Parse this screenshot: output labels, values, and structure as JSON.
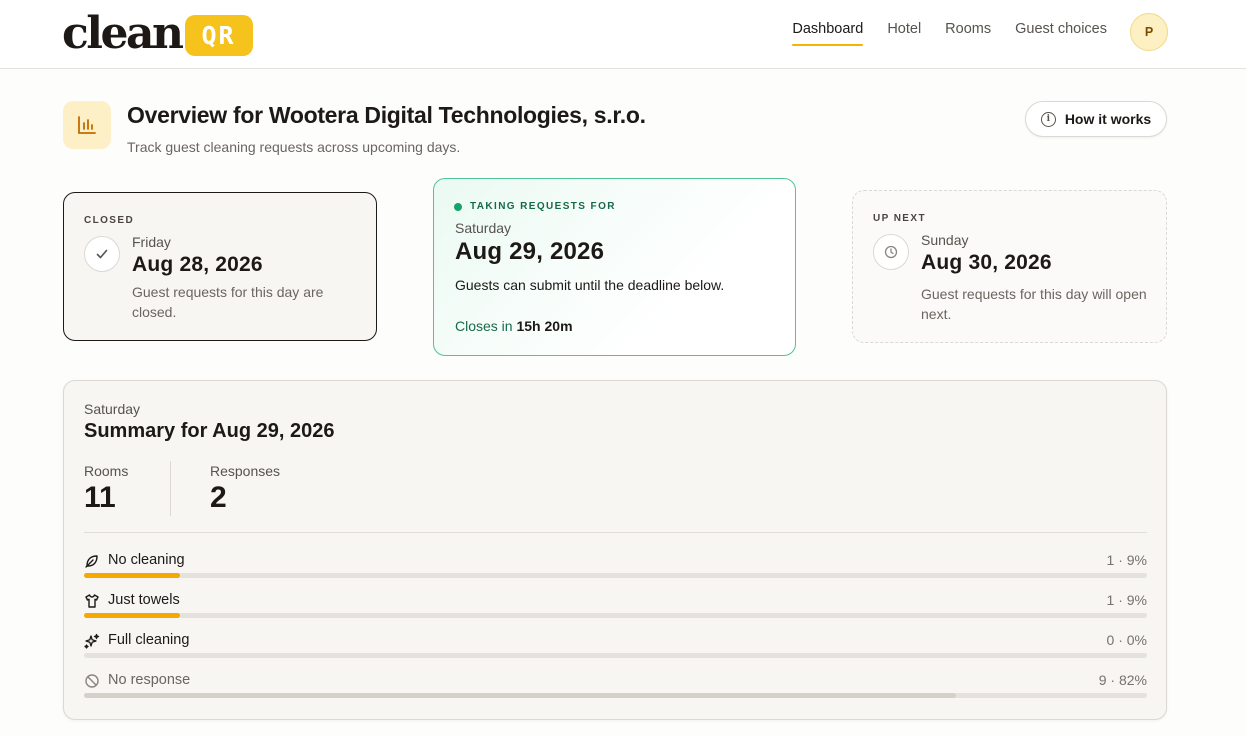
{
  "brand": {
    "word": "clean",
    "badge": "QR",
    "accent": "#f6c21c"
  },
  "nav": {
    "items": [
      {
        "label": "Dashboard",
        "active": true
      },
      {
        "label": "Hotel",
        "active": false
      },
      {
        "label": "Rooms",
        "active": false
      },
      {
        "label": "Guest choices",
        "active": false
      }
    ],
    "avatar_initial": "P"
  },
  "page": {
    "title": "Overview for Wootera Digital Technologies, s.r.o.",
    "subtitle": "Track guest cleaning requests across upcoming days.",
    "icon": "bar-chart-icon",
    "how_it_works_label": "How it works"
  },
  "days": {
    "closed": {
      "status": "CLOSED",
      "weekday": "Friday",
      "date": "Aug 28, 2026",
      "description": "Guest requests for this day are closed.",
      "icon": "check-icon"
    },
    "open": {
      "status": "TAKING REQUESTS FOR",
      "weekday": "Saturday",
      "date": "Aug 29, 2026",
      "description": "Guests can submit until the deadline below.",
      "closes_prefix": "Closes in",
      "closes_value": "15h 20m",
      "color": "#16a36a"
    },
    "next": {
      "status": "UP NEXT",
      "weekday": "Sunday",
      "date": "Aug 30, 2026",
      "description": "Guest requests for this day will open next.",
      "icon": "clock-icon"
    }
  },
  "summary": {
    "weekday": "Saturday",
    "title": "Summary for Aug 29, 2026",
    "rooms_label": "Rooms",
    "rooms_value": "11",
    "responses_label": "Responses",
    "responses_value": "2",
    "choices": [
      {
        "label": "No cleaning",
        "icon": "leaf-icon",
        "count": 1,
        "percent": 9,
        "stat": "1 · 9%"
      },
      {
        "label": "Just towels",
        "icon": "shirt-icon",
        "count": 1,
        "percent": 9,
        "stat": "1 · 9%"
      },
      {
        "label": "Full cleaning",
        "icon": "sparkles-icon",
        "count": 0,
        "percent": 0,
        "stat": "0 · 0%"
      },
      {
        "label": "No response",
        "icon": "ban-icon",
        "count": 9,
        "percent": 82,
        "stat": "9 · 82%"
      }
    ],
    "bar_color": "#f5a800",
    "muted_bar_color": "#d4d0ca"
  }
}
